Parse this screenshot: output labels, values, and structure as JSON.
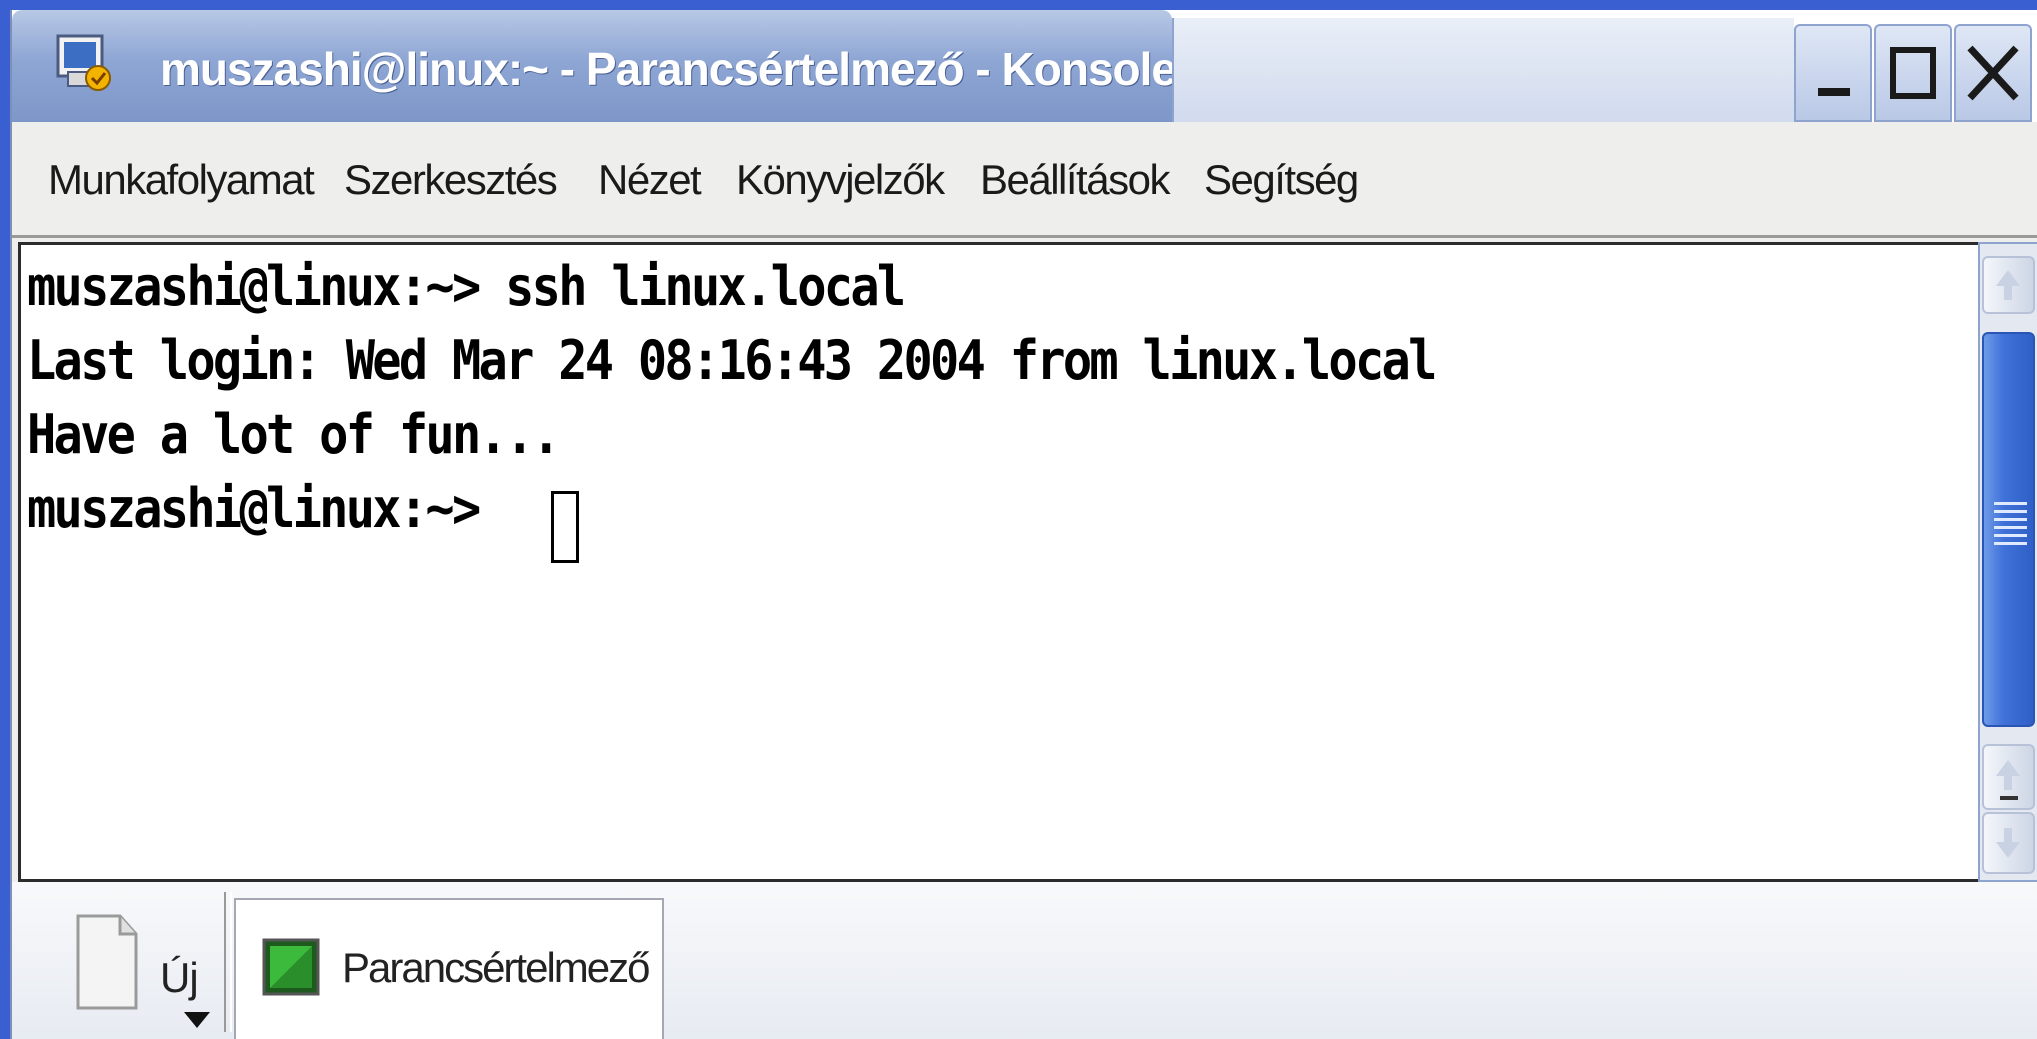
{
  "window": {
    "title": "muszashi@linux:~ - Parancsértelmező - Konsole",
    "controls": {
      "minimize": "minimize",
      "maximize": "maximize",
      "close": "close"
    }
  },
  "menu": {
    "items": [
      "Munkafolyamat",
      "Szerkesztés",
      "Nézet",
      "Könyvjelzők",
      "Beállítások",
      "Segítség"
    ]
  },
  "terminal": {
    "lines": [
      "muszashi@linux:~> ssh linux.local",
      "Last login: Wed Mar 24 08:16:43 2004 from linux.local",
      "Have a lot of fun...",
      "muszashi@linux:~> "
    ]
  },
  "tabbar": {
    "new_label": "Új",
    "tabs": [
      {
        "label": "Parancsértelmező"
      }
    ]
  },
  "icons": {
    "app": "konsole-app-icon",
    "new_session": "new-document-icon",
    "session": "terminal-session-icon",
    "dropdown": "dropdown-arrow-icon"
  },
  "colors": {
    "desktop": "#3a5fd0",
    "title_active": "#8ea6d4",
    "scroll_thumb": "#3f72d9",
    "terminal_bg": "#ffffff",
    "terminal_fg": "#000000"
  }
}
